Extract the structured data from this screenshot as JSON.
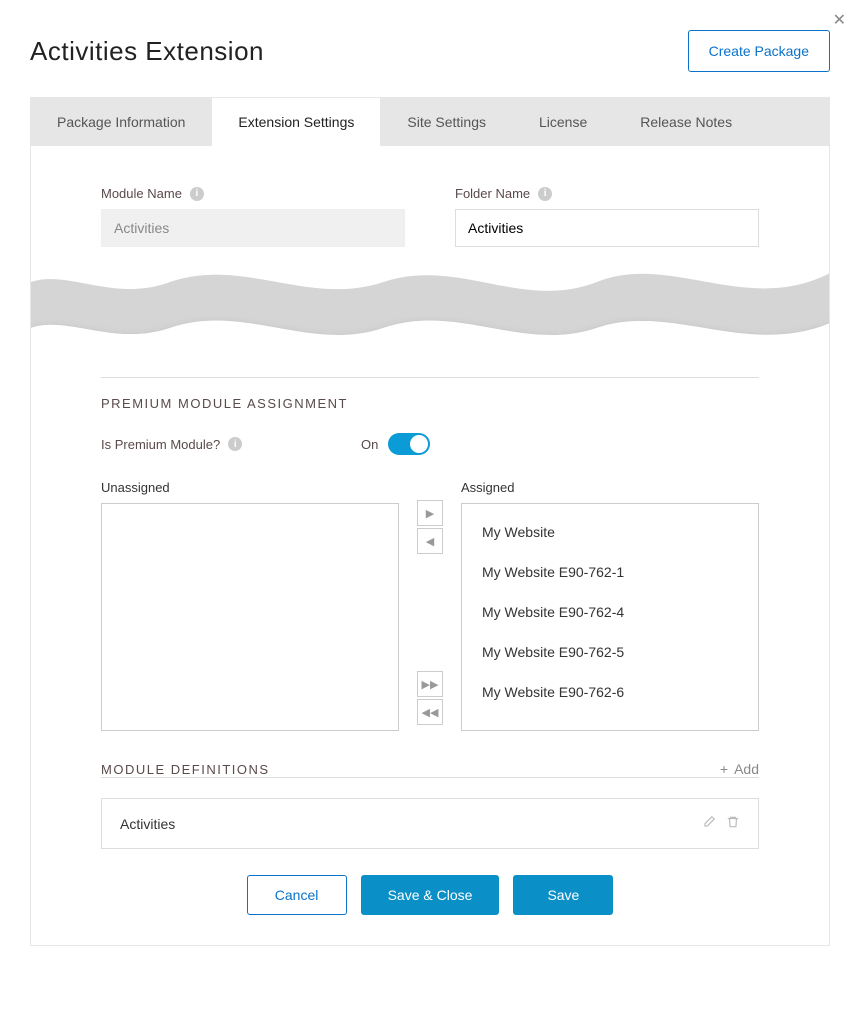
{
  "header": {
    "title": "Activities Extension",
    "create_button": "Create Package",
    "close_icon": "✕"
  },
  "tabs": [
    {
      "label": "Package Information"
    },
    {
      "label": "Extension Settings"
    },
    {
      "label": "Site Settings"
    },
    {
      "label": "License"
    },
    {
      "label": "Release Notes"
    }
  ],
  "form": {
    "module_name_label": "Module Name",
    "module_name_value": "Activities",
    "folder_name_label": "Folder Name",
    "folder_name_value": "Activities"
  },
  "premium": {
    "section_title": "PREMIUM MODULE ASSIGNMENT",
    "question_label": "Is Premium Module?",
    "toggle_state": "On"
  },
  "dual_list": {
    "unassigned_label": "Unassigned",
    "assigned_label": "Assigned",
    "unassigned_items": [],
    "assigned_items": [
      "My Website",
      "My Website E90-762-1",
      "My Website E90-762-4",
      "My Website E90-762-5",
      "My Website E90-762-6"
    ]
  },
  "definitions": {
    "section_title": "MODULE DEFINITIONS",
    "add_label": "Add",
    "row_name": "Activities"
  },
  "footer": {
    "cancel": "Cancel",
    "save_close": "Save & Close",
    "save": "Save"
  },
  "icons": {
    "info": "i",
    "plus": "+",
    "right": "▶",
    "left": "◀",
    "double_right": "▶▶",
    "double_left": "◀◀"
  }
}
